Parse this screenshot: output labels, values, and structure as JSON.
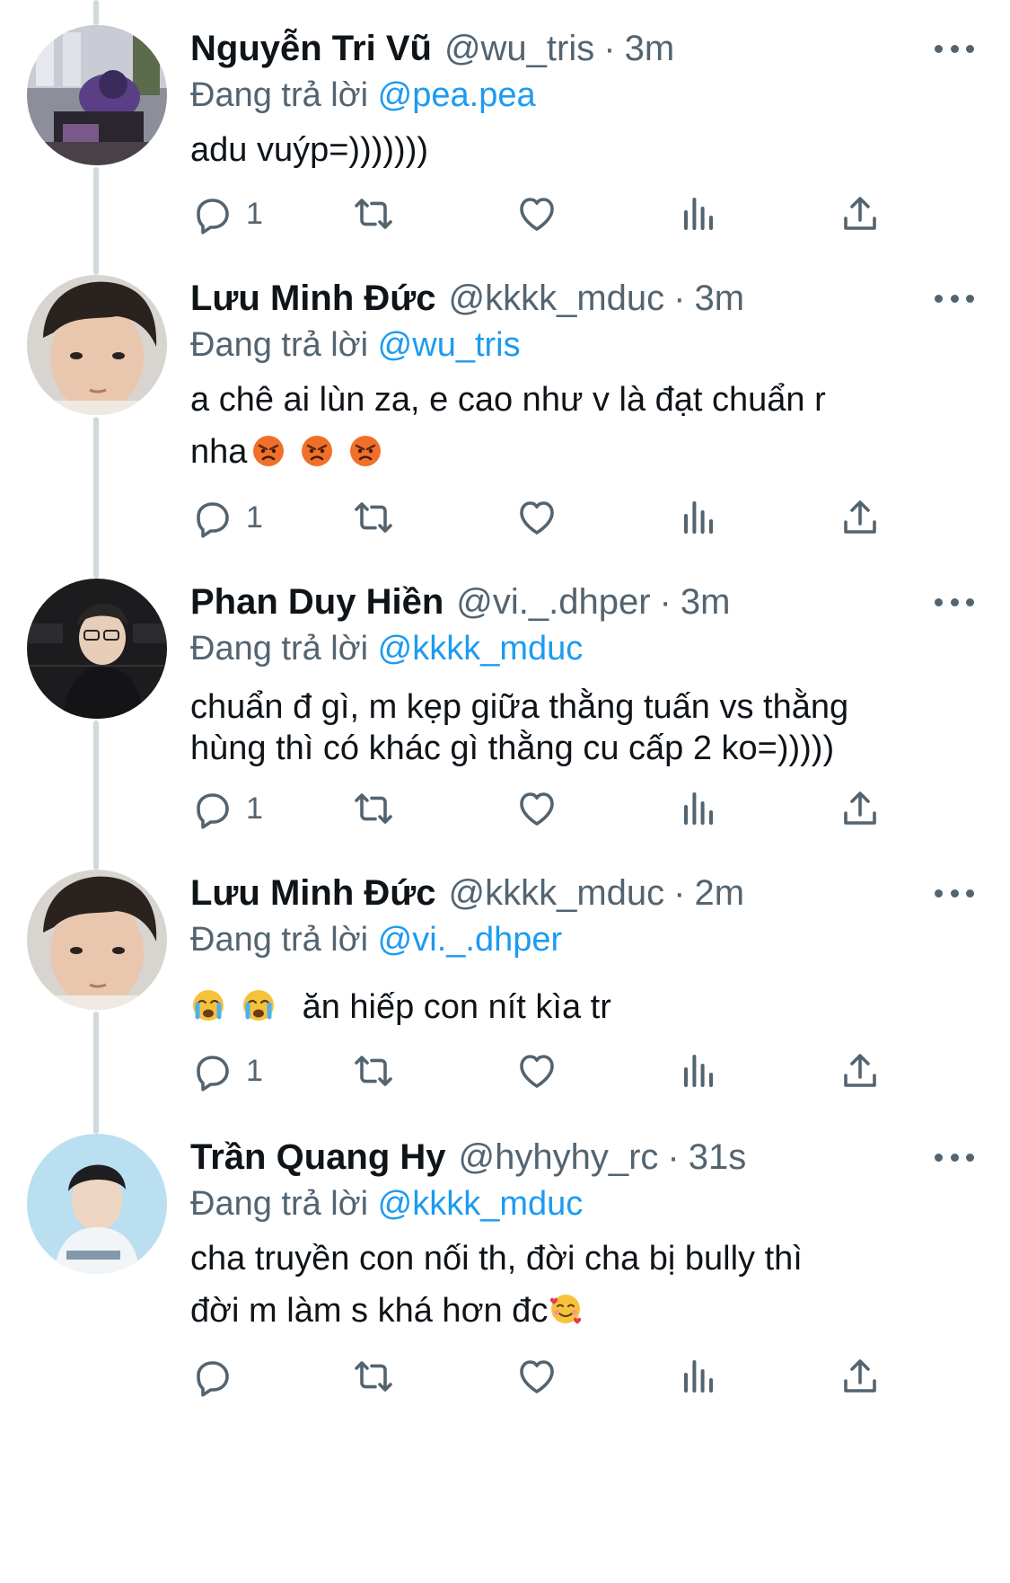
{
  "tweets": [
    {
      "name": "Nguyễn Tri Vũ",
      "handle": "@wu_tris",
      "dot": "·",
      "time": "3m",
      "reply_prefix": "Đang trả lời",
      "reply_to": "@pea.pea",
      "text": "adu vuýp=)))))))",
      "reply_count": "1",
      "avatar_icon": "profile-photo"
    },
    {
      "name": "Lưu Minh Đức",
      "handle": "@kkkk_mduc",
      "dot": "·",
      "time": "3m",
      "reply_prefix": "Đang trả lời",
      "reply_to": "@wu_tris",
      "text_line1": "a chê ai lùn za, e cao như v là đạt chuẩn r",
      "text_line2": "nha",
      "emojis": [
        "angry-face",
        "angry-face",
        "angry-face"
      ],
      "reply_count": "1",
      "avatar_icon": "profile-photo"
    },
    {
      "name": "Phan Duy Hiền",
      "handle": "@vi._.dhper",
      "dot": "·",
      "time": "3m",
      "reply_prefix": "Đang trả lời",
      "reply_to": "@kkkk_mduc",
      "text_line1": "chuẩn đ gì, m kẹp giữa thằng tuấn vs thằng",
      "text_line2": "hùng thì có khác gì thằng cu cấp 2 ko=)))))",
      "reply_count": "1",
      "avatar_icon": "profile-photo"
    },
    {
      "name": "Lưu Minh Đức",
      "handle": "@kkkk_mduc",
      "dot": "·",
      "time": "2m",
      "reply_prefix": "Đang trả lời",
      "reply_to": "@vi._.dhper",
      "emojis": [
        "crying-face",
        "crying-face"
      ],
      "text": "ăn hiếp con nít kìa tr",
      "reply_count": "1",
      "avatar_icon": "profile-photo"
    },
    {
      "name": "Trần Quang Hy",
      "handle": "@hyhyhy_rc",
      "dot": "·",
      "time": "31s",
      "reply_prefix": "Đang trả lời",
      "reply_to": "@kkkk_mduc",
      "text_line1": "cha truyền con nối th, đời cha bị bully thì",
      "text_line2": "đời m làm s khá hơn đc",
      "emojis": [
        "smiling-face-with-hearts"
      ],
      "reply_count": "",
      "avatar_icon": "profile-photo"
    }
  ],
  "icons": {
    "reply": "reply-icon",
    "retweet": "retweet-icon",
    "like": "like-icon",
    "views": "views-icon",
    "share": "share-icon",
    "more": "more-icon"
  },
  "colors": {
    "text": "#0f1419",
    "secondary": "#536471",
    "accent": "#1d9bf0",
    "thread_line": "#cfd9de"
  }
}
